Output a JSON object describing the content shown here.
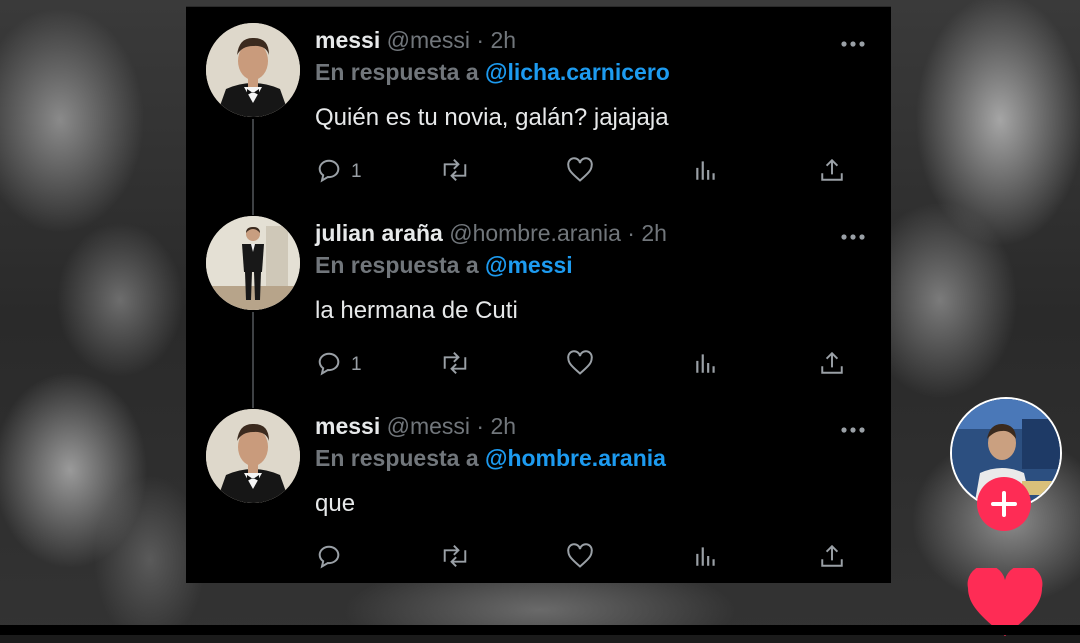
{
  "tweets": [
    {
      "name": "messi",
      "handle": "@messi",
      "time": "· 2h",
      "reply_label": "En respuesta a",
      "reply_to": "@licha.carnicero",
      "text": "Quién es tu novia, galán? jajajaja",
      "reply_count": "1"
    },
    {
      "name": "julian araña",
      "handle": "@hombre.arania",
      "time": "· 2h",
      "reply_label": "En respuesta a",
      "reply_to": "@messi",
      "text": "la hermana de Cuti",
      "reply_count": "1"
    },
    {
      "name": "messi",
      "handle": "@messi",
      "time": "· 2h",
      "reply_label": "En respuesta a",
      "reply_to": "@hombre.arania",
      "text": "que",
      "reply_count": ""
    }
  ],
  "icons": {
    "reply": "reply-icon",
    "retweet": "retweet-icon",
    "like": "heart-icon",
    "views": "analytics-icon",
    "share": "share-icon",
    "more": "more-dots-icon"
  },
  "colors": {
    "mention": "#1d9bf0",
    "muted": "#71767b",
    "text": "#e7e9ea",
    "tiktok_red": "#fe2c55"
  }
}
